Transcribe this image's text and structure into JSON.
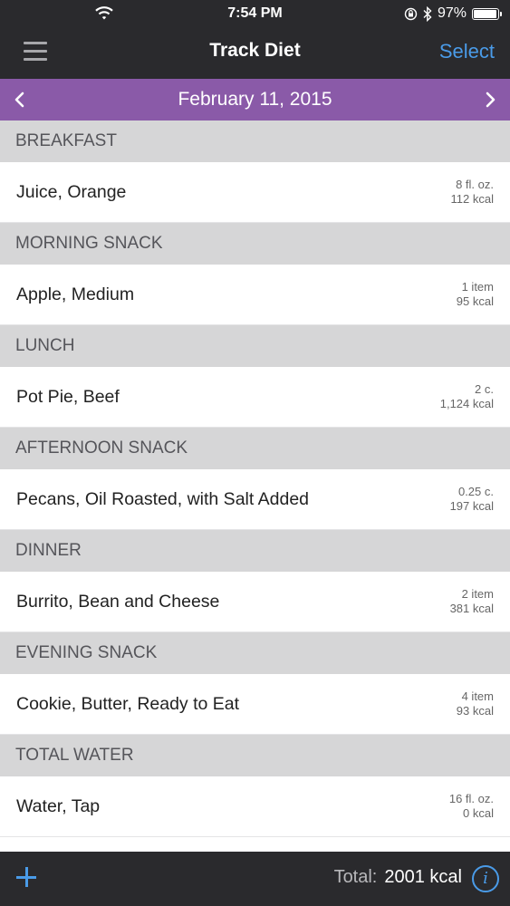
{
  "status_bar": {
    "time": "7:54 PM",
    "battery": "97%",
    "icons": [
      "wifi-icon",
      "orientation-lock-icon",
      "bluetooth-icon",
      "battery-icon"
    ]
  },
  "navbar": {
    "title": "Track Diet",
    "select_label": "Select",
    "menu_icon": "hamburger-menu-icon"
  },
  "date_bar": {
    "date": "February 11, 2015",
    "accent": "#8a5aa8"
  },
  "sections": [
    {
      "header": "BREAKFAST",
      "items": [
        {
          "name": "Juice, Orange",
          "amount": "8 fl. oz.",
          "kcal": "112 kcal"
        }
      ]
    },
    {
      "header": "MORNING SNACK",
      "items": [
        {
          "name": "Apple, Medium",
          "amount": "1 item",
          "kcal": "95 kcal"
        }
      ]
    },
    {
      "header": "LUNCH",
      "items": [
        {
          "name": "Pot Pie, Beef",
          "amount": "2 c.",
          "kcal": "1,124 kcal"
        }
      ]
    },
    {
      "header": "AFTERNOON SNACK",
      "items": [
        {
          "name": "Pecans, Oil Roasted, with Salt Added",
          "amount": "0.25 c.",
          "kcal": "197 kcal"
        }
      ]
    },
    {
      "header": "DINNER",
      "items": [
        {
          "name": "Burrito, Bean and Cheese",
          "amount": "2 item",
          "kcal": "381 kcal"
        }
      ]
    },
    {
      "header": "EVENING SNACK",
      "items": [
        {
          "name": "Cookie, Butter, Ready to Eat",
          "amount": "4 item",
          "kcal": "93 kcal"
        }
      ]
    },
    {
      "header": "TOTAL WATER",
      "items": [
        {
          "name": "Water, Tap",
          "amount": "16 fl. oz.",
          "kcal": "0 kcal"
        }
      ]
    }
  ],
  "footer": {
    "total_label": "Total:",
    "total_value": "2001 kcal",
    "accent": "#4a9be8"
  }
}
